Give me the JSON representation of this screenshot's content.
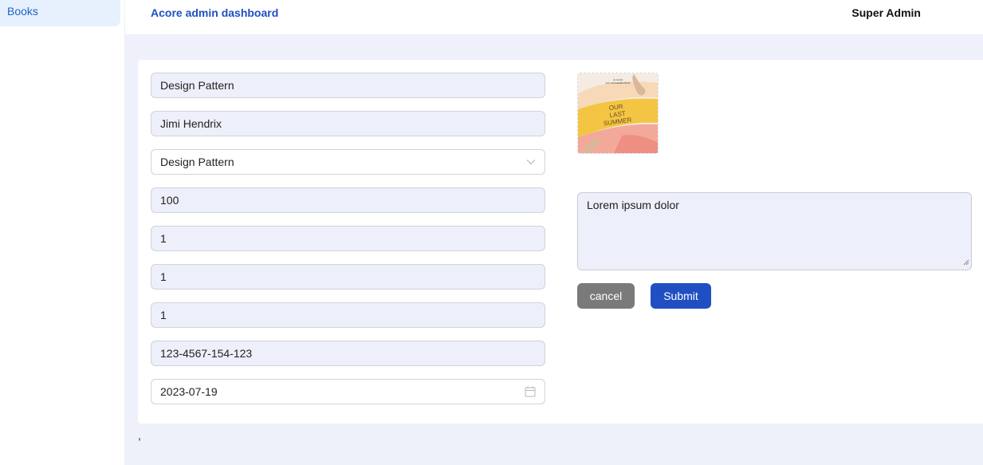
{
  "sidebar": {
    "items": [
      {
        "label": "Books"
      }
    ]
  },
  "header": {
    "title": "Acore admin dashboard",
    "user": "Super Admin"
  },
  "form": {
    "title": "Design Pattern",
    "author": "Jimi Hendrix",
    "category": "Design Pattern",
    "price": "100",
    "field5": "1",
    "field6": "1",
    "field7": "1",
    "isbn": "123-4567-154-123",
    "date": "2023-07-19",
    "description": "Lorem ipsum dolor",
    "cover_text": {
      "author": "Jo Lioreli",
      "subtitle": "Our Unbreakable Bond",
      "title_line1": "OUR",
      "title_line2": "LAST",
      "title_line3": "SUMMER"
    }
  },
  "actions": {
    "cancel_label": "cancel",
    "submit_label": "Submit"
  },
  "footer_text": ",",
  "colors": {
    "accent": "#1f4fc2",
    "cancel": "#7a7a7a",
    "input_bg": "#edeffa",
    "page_bg": "#eef0fa",
    "sidebar_active": "#e6f1fd"
  },
  "icons": {
    "select": "chevron-down-icon",
    "date": "calendar-icon"
  }
}
